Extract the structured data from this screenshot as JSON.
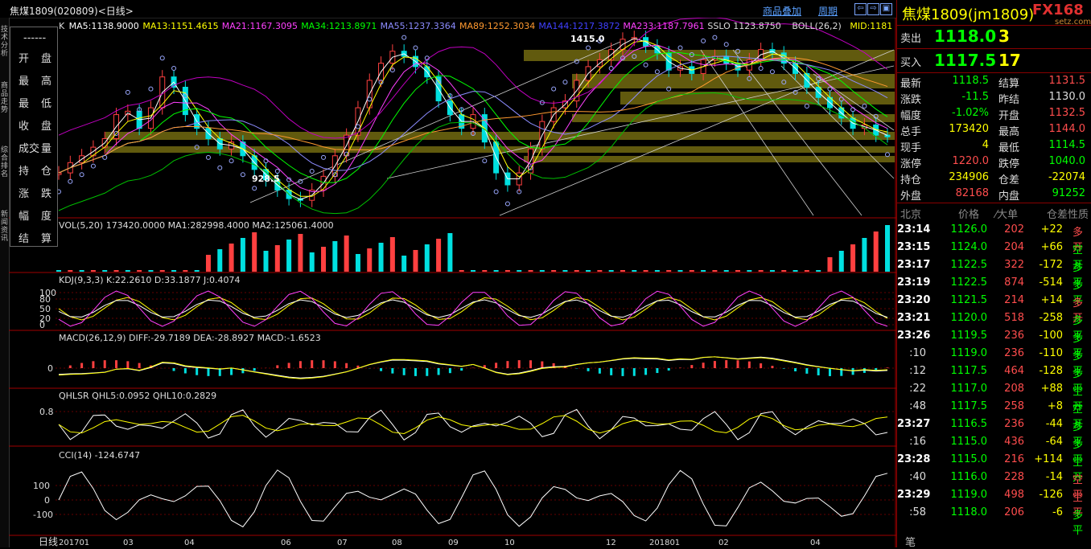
{
  "window": {
    "title": "焦煤1809(020809)<日线>",
    "overlay_btn": "商品叠加",
    "period_btn": "周期",
    "nav_btns": [
      "⇦",
      "⇨",
      "▣"
    ]
  },
  "left_tabs": [
    "技术分析",
    "商品走势",
    "综合排名",
    "新闻资讯"
  ],
  "bottom_tag": "日线",
  "info_box": {
    "rows": [
      [
        "开",
        "盘"
      ],
      [
        "最",
        "高"
      ],
      [
        "最",
        "低"
      ],
      [
        "收",
        "盘"
      ],
      [
        "成交",
        "量"
      ],
      [
        "持",
        "仓"
      ],
      [
        "涨",
        "跌"
      ],
      [
        "幅",
        "度"
      ],
      [
        "结",
        "算"
      ]
    ],
    "top": "------"
  },
  "chart_data": [
    {
      "type": "candlestick",
      "panel": "K",
      "legend": [
        {
          "name": "K",
          "text": "K",
          "color": "#dddddd"
        },
        {
          "name": "MA5",
          "text": "MA5:1138.9000",
          "color": "#ffffff"
        },
        {
          "name": "MA13",
          "text": "MA13:1151.4615",
          "color": "#ffff00"
        },
        {
          "name": "MA21",
          "text": "MA21:1167.3095",
          "color": "#ff40ff"
        },
        {
          "name": "MA34",
          "text": "MA34:1213.8971",
          "color": "#00ff00"
        },
        {
          "name": "MA55",
          "text": "MA55:1237.3364",
          "color": "#8c8cff"
        },
        {
          "name": "MA89",
          "text": "MA89:1252.3034",
          "color": "#ff9a30"
        },
        {
          "name": "MA144",
          "text": "MA144:1217.3872",
          "color": "#4040ff"
        },
        {
          "name": "MA233",
          "text": "MA233:1187.7961",
          "color": "#ff40ff"
        },
        {
          "name": "SSLO",
          "text": "SSLO  1123.8750",
          "color": "#dddddd"
        },
        {
          "name": "BOLL",
          "text": "BOLL(26,2)",
          "color": "#dddddd"
        },
        {
          "name": "MID",
          "text": "MID:1181",
          "color": "#ffff00"
        }
      ],
      "annotations": [
        {
          "text": "1415.0"
        },
        {
          "text": "928.5"
        }
      ],
      "x_labels": [
        "201701",
        "03",
        "04",
        "06",
        "07",
        "08",
        "09",
        "10",
        "12",
        "201801",
        "02",
        "04"
      ],
      "price_series": [
        1010,
        1040,
        1060,
        1085,
        1110,
        1180,
        1190,
        1140,
        1200,
        1290,
        1260,
        1180,
        1140,
        1110,
        1080,
        1100,
        1060,
        1020,
        990,
        960,
        935,
        930,
        960,
        1000,
        1060,
        1120,
        1200,
        1280,
        1330,
        1365,
        1350,
        1320,
        1290,
        1220,
        1180,
        1140,
        1180,
        1100,
        1010,
        975,
        1010,
        1080,
        1160,
        1200,
        1220,
        1280,
        1320,
        1340,
        1370,
        1400,
        1405,
        1380,
        1360,
        1310,
        1320,
        1300,
        1340,
        1350,
        1330,
        1310,
        1340,
        1370,
        1360,
        1330,
        1300,
        1260,
        1230,
        1200,
        1170,
        1140,
        1150,
        1120,
        1118.5
      ],
      "volume": {
        "legend": "VOL(5,20)  173420.0000  MA1:282998.4000  MA2:125061.4000"
      },
      "kdj": {
        "legend": "KDJ(9,3,3)  K:22.2610  D:33.1877  J:0.4074",
        "ticks": [
          "100",
          "80",
          "50",
          "20",
          "0"
        ]
      },
      "macd": {
        "legend": "MACD(26,12,9)  DIFF:-29.7189  DEA:-28.8927  MACD:-1.6523",
        "ticks": [
          "0"
        ]
      },
      "qhlsr": {
        "legend": "QHLSR  QHL5:0.0952  QHL10:0.2829",
        "ticks": [
          "0.8"
        ]
      },
      "cci": {
        "legend": "CCI(14)  -124.6747",
        "ticks": [
          "100",
          "0",
          "-100"
        ]
      }
    }
  ],
  "quote": {
    "name": "焦煤1809(jm1809)",
    "logo": "FX168",
    "site": "setz.com",
    "sell_label": "卖出",
    "sell_price": "1118.0",
    "sell_qty": "3",
    "buy_label": "买入",
    "buy_price": "1117.5",
    "buy_qty": "17",
    "fields": [
      [
        "最新",
        "1118.5",
        "g",
        "结算",
        "1131.5",
        "r"
      ],
      [
        "涨跌",
        "-11.5",
        "g",
        "昨结",
        "1130.0",
        "w"
      ],
      [
        "幅度",
        "-1.02%",
        "g",
        "开盘",
        "1132.5",
        "r"
      ],
      [
        "总手",
        "173420",
        "y",
        "最高",
        "1144.0",
        "r"
      ],
      [
        "现手",
        "4",
        "y",
        "最低",
        "1114.5",
        "g"
      ],
      [
        "涨停",
        "1220.0",
        "r",
        "跌停",
        "1040.0",
        "g"
      ],
      [
        "持仓",
        "234906",
        "y",
        "仓差",
        "-22074",
        "y"
      ],
      [
        "外盘",
        "82168",
        "r",
        "内盘",
        "91252",
        "g"
      ]
    ],
    "tick_header": [
      "北京",
      "价格",
      "⁄大单",
      "仓差",
      "性质"
    ],
    "ticks": [
      [
        "23:14",
        "1126.0",
        "202",
        "+22",
        "多开",
        "r"
      ],
      [
        "23:15",
        "1124.0",
        "204",
        "+66",
        "空开",
        "g"
      ],
      [
        "23:17",
        "1122.5",
        "322",
        "-172",
        "多平",
        "g"
      ],
      [
        "23:19",
        "1122.5",
        "874",
        "-514",
        "多平",
        "g"
      ],
      [
        "23:20",
        "1121.5",
        "214",
        "+14",
        "多开",
        "r"
      ],
      [
        "23:21",
        "1120.0",
        "518",
        "-258",
        "多平",
        "g"
      ],
      [
        "23:26",
        "1119.5",
        "236",
        "-100",
        "多平",
        "g"
      ],
      [
        ":10",
        "1119.0",
        "236",
        "-110",
        "多平",
        "g"
      ],
      [
        ":12",
        "1117.5",
        "464",
        "-128",
        "多平",
        "g"
      ],
      [
        ":22",
        "1117.0",
        "208",
        "+88",
        "空开",
        "g"
      ],
      [
        ":48",
        "1117.5",
        "258",
        "+8",
        "空开",
        "g"
      ],
      [
        "23:27",
        "1116.5",
        "236",
        "-44",
        "多平",
        "g"
      ],
      [
        ":16",
        "1115.0",
        "436",
        "-64",
        "多平",
        "g"
      ],
      [
        "23:28",
        "1115.0",
        "216",
        "+114",
        "空开",
        "g"
      ],
      [
        ":40",
        "1116.0",
        "228",
        "-14",
        "空平",
        "r"
      ],
      [
        "23:29",
        "1119.0",
        "498",
        "-126",
        "空平",
        "r"
      ],
      [
        ":58",
        "1118.0",
        "206",
        "-6",
        "多平",
        "g"
      ]
    ],
    "bottom_label": "笔"
  }
}
